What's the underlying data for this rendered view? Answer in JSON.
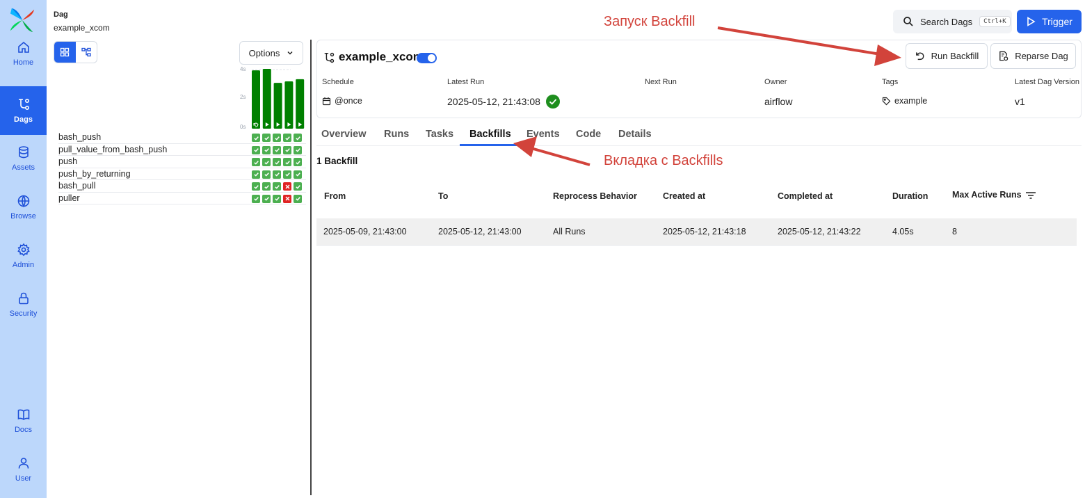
{
  "nav": {
    "items": [
      {
        "label": "Home",
        "icon": "home-icon"
      },
      {
        "label": "Dags",
        "icon": "dags-icon",
        "active": true
      },
      {
        "label": "Assets",
        "icon": "database-icon"
      },
      {
        "label": "Browse",
        "icon": "globe-icon"
      },
      {
        "label": "Admin",
        "icon": "gear-icon"
      },
      {
        "label": "Security",
        "icon": "lock-icon"
      },
      {
        "label": "Docs",
        "icon": "book-icon"
      },
      {
        "label": "User",
        "icon": "user-icon"
      }
    ]
  },
  "breadcrumb": {
    "label": "Dag",
    "dag_id": "example_xcom"
  },
  "header": {
    "search_label": "Search Dags",
    "search_shortcut": "Ctrl+K",
    "trigger_label": "Trigger"
  },
  "left_panel": {
    "options_label": "Options",
    "duration_chart": {
      "y_ticks": [
        "4s",
        "2s",
        "0s"
      ],
      "durations_s": [
        3.95,
        4.05,
        3.1,
        3.2,
        3.35
      ],
      "run_kinds": [
        "backfill",
        "manual",
        "manual",
        "manual",
        "manual"
      ]
    },
    "tasks": [
      {
        "name": "bash_push",
        "states": [
          "success",
          "success",
          "success",
          "success",
          "success"
        ]
      },
      {
        "name": "pull_value_from_bash_push",
        "states": [
          "success",
          "success",
          "success",
          "success",
          "success"
        ]
      },
      {
        "name": "push",
        "states": [
          "success",
          "success",
          "success",
          "success",
          "success"
        ]
      },
      {
        "name": "push_by_returning",
        "states": [
          "success",
          "success",
          "success",
          "success",
          "success"
        ]
      },
      {
        "name": "bash_pull",
        "states": [
          "success",
          "success",
          "success",
          "failed",
          "success"
        ]
      },
      {
        "name": "puller",
        "states": [
          "success",
          "success",
          "success",
          "failed",
          "success"
        ]
      }
    ]
  },
  "dag": {
    "title": "example_xcom",
    "paused": false,
    "buttons": {
      "run_backfill": "Run Backfill",
      "reparse": "Reparse Dag"
    },
    "meta": {
      "schedule": {
        "label": "Schedule",
        "value": "@once"
      },
      "latest_run": {
        "label": "Latest Run",
        "value": "2025-05-12, 21:43:08"
      },
      "next_run": {
        "label": "Next Run",
        "value": ""
      },
      "owner": {
        "label": "Owner",
        "value": "airflow"
      },
      "tags": {
        "label": "Tags",
        "value": "example"
      },
      "version": {
        "label": "Latest Dag Version",
        "value": "v1"
      }
    }
  },
  "tabs": [
    {
      "label": "Overview"
    },
    {
      "label": "Runs"
    },
    {
      "label": "Tasks"
    },
    {
      "label": "Backfills",
      "active": true
    },
    {
      "label": "Events"
    },
    {
      "label": "Code"
    },
    {
      "label": "Details"
    }
  ],
  "backfills": {
    "count_label": "1 Backfill",
    "columns": [
      "From",
      "To",
      "Reprocess Behavior",
      "Created at",
      "Completed at",
      "Duration",
      "Max Active Runs"
    ],
    "rows": [
      [
        "2025-05-09, 21:43:00",
        "2025-05-12, 21:43:00",
        "All Runs",
        "2025-05-12, 21:43:18",
        "2025-05-12, 21:43:22",
        "4.05s",
        "8"
      ]
    ]
  },
  "annotations": {
    "run_backfill": "Запуск Backfill",
    "backfills_tab": "Вкладка с Backfills"
  },
  "colors": {
    "nav_bg": "#bcd7fb",
    "accent": "#2563eb",
    "success": "#4caf50",
    "failed": "#e02424",
    "annotation": "#d2433b",
    "bar": "#008000"
  }
}
